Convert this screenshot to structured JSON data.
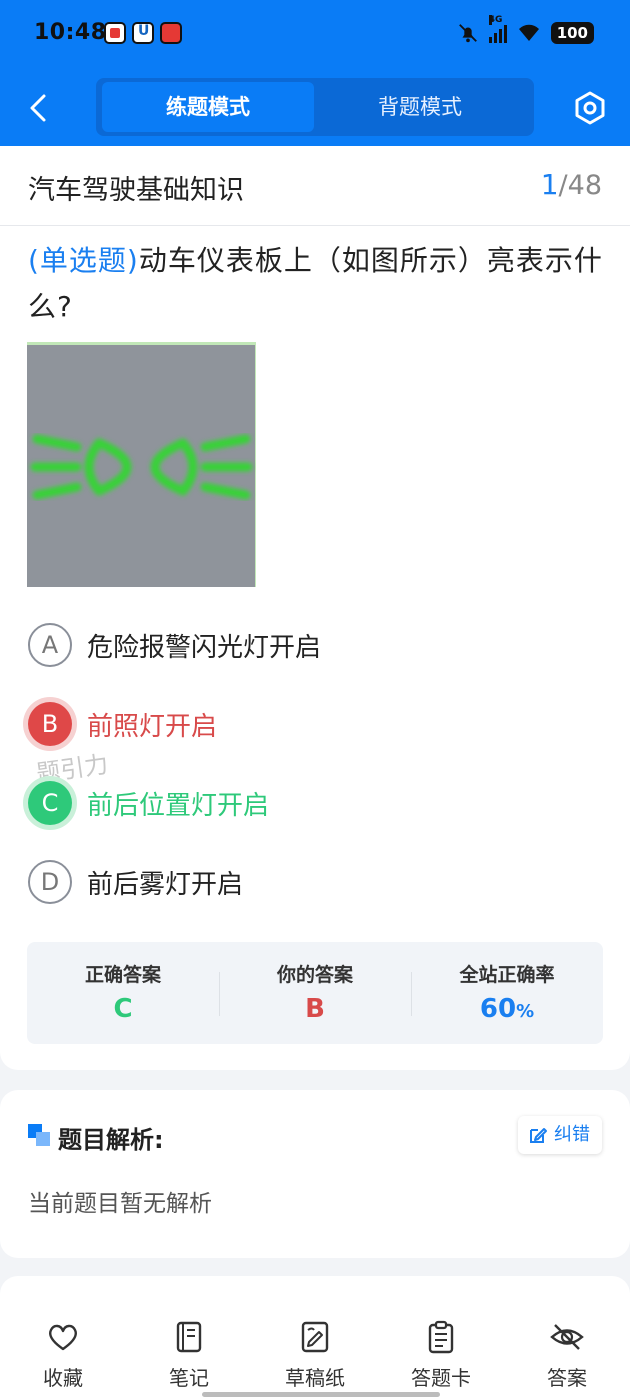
{
  "status_bar": {
    "time": "10:48",
    "network": "4G",
    "battery": "100"
  },
  "header": {
    "mode_tabs": [
      {
        "label": "练题模式",
        "active": true
      },
      {
        "label": "背题模式",
        "active": false
      }
    ],
    "accent_color": "#0a7cf6"
  },
  "question": {
    "subject": "汽车驾驶基础知识",
    "progress_current": "1",
    "progress_total": "/48",
    "type_label": "(单选题)",
    "text": "动车仪表板上（如图所示）亮表示什么?",
    "image_icon": "front-rear-position-lights-icon",
    "options": [
      {
        "letter": "A",
        "text": "危险报警闪光灯开启",
        "state": "normal"
      },
      {
        "letter": "B",
        "text": "前照灯开启",
        "state": "wrong"
      },
      {
        "letter": "C",
        "text": "前后位置灯开启",
        "state": "correct"
      },
      {
        "letter": "D",
        "text": "前后雾灯开启",
        "state": "normal"
      }
    ],
    "watermark": "题引力"
  },
  "answer_summary": {
    "correct_label": "正确答案",
    "correct_value": "C",
    "yours_label": "你的答案",
    "yours_value": "B",
    "rate_label": "全站正确率",
    "rate_value": "60",
    "rate_unit": "%",
    "colors": {
      "correct": "#2ec97a",
      "wrong": "#d84a4a",
      "rate": "#1a7ff0"
    }
  },
  "analysis": {
    "title": "题目解析:",
    "fix_button": "纠错",
    "text": "当前题目暂无解析"
  },
  "bottom_tabs": [
    {
      "label": "收藏",
      "icon": "heart-icon"
    },
    {
      "label": "笔记",
      "icon": "notebook-icon"
    },
    {
      "label": "草稿纸",
      "icon": "scratch-paper-icon"
    },
    {
      "label": "答题卡",
      "icon": "clipboard-icon"
    },
    {
      "label": "答案",
      "icon": "eye-off-icon"
    }
  ]
}
